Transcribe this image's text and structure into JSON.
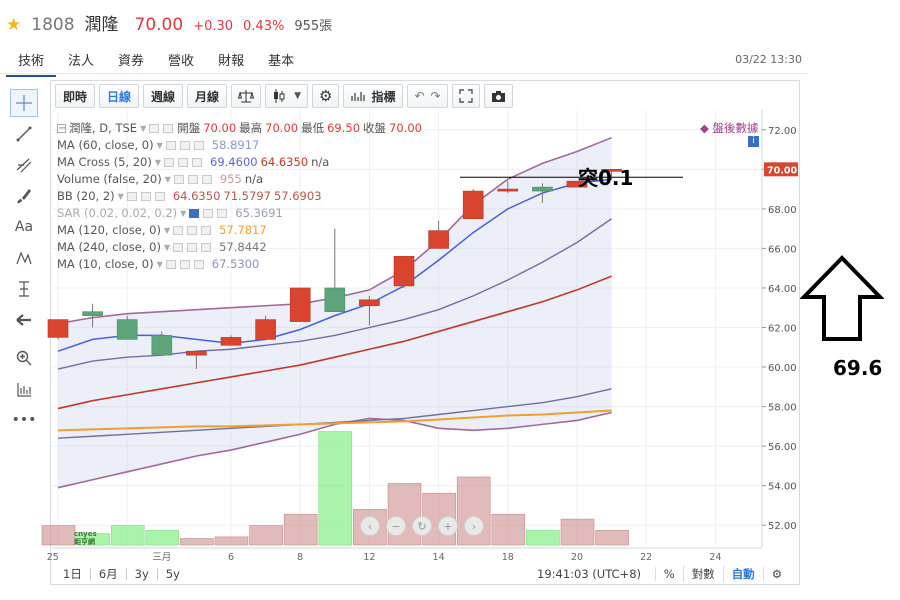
{
  "stock": {
    "symbol": "1808",
    "name": "潤隆",
    "price": "70.00",
    "change": "+0.30",
    "percent": "0.43%",
    "volume": "955張"
  },
  "nav": {
    "tabs": [
      {
        "label": "技術"
      },
      {
        "label": "法人"
      },
      {
        "label": "資券"
      },
      {
        "label": "營收"
      },
      {
        "label": "財報"
      },
      {
        "label": "基本"
      }
    ],
    "datetime": "03/22 13:30"
  },
  "toolbar": {
    "intraday": "即時",
    "daily": "日線",
    "weekly": "週線",
    "monthly": "月線",
    "indicators": "指標"
  },
  "legend": {
    "title": {
      "label": "潤隆, D, TSE",
      "open_l": "開盤",
      "open": "70.00",
      "high_l": "最高",
      "high": "70.00",
      "low_l": "最低",
      "low": "69.50",
      "close_l": "收盤",
      "close": "70.00"
    },
    "rows": [
      {
        "label": "MA (60, close, 0)",
        "value": "58.8917",
        "color": "#8899c9"
      },
      {
        "label": "MA Cross (5, 20)",
        "value": "69.4600",
        "value2": "64.6350",
        "extra": "n/a",
        "color": "#5b63d8",
        "color2": "#c0392b"
      },
      {
        "label": "Volume (false, 20)",
        "value": "955",
        "extra": "n/a",
        "color": "#c89c9c"
      },
      {
        "label": "BB (20, 2)",
        "value": "64.6350",
        "value2": "71.5797",
        "value3": "57.6903",
        "color": "#b8554f"
      },
      {
        "label": "SAR (0.02, 0.02, 0.2)",
        "value": "65.3691",
        "color": "#9aa0b0"
      },
      {
        "label": "MA (120, close, 0)",
        "value": "57.7817",
        "color": "#f0a030"
      },
      {
        "label": "MA (240, close, 0)",
        "value": "57.8442",
        "color": "#777"
      },
      {
        "label": "MA (10, close, 0)",
        "value": "67.5300",
        "color": "#8a92c0"
      }
    ]
  },
  "after_hours": "◆ 盤後數據",
  "info_icon_label": "i",
  "price_tag": "70.00",
  "chart_data": {
    "type": "candlestick",
    "y_axis": {
      "ticks": [
        "72.00",
        "70.00",
        "68.00",
        "66.00",
        "64.00",
        "62.00",
        "60.00",
        "58.00",
        "56.00",
        "54.00",
        "52.00"
      ],
      "range": [
        51.0,
        73.0
      ]
    },
    "x_axis": {
      "ticks": [
        "25",
        "三月",
        "6",
        "8",
        "12",
        "14",
        "18",
        "20",
        "22",
        "24"
      ]
    },
    "candles": [
      {
        "o": 61.5,
        "h": 62.4,
        "l": 61.4,
        "c": 62.4,
        "up": true
      },
      {
        "o": 62.6,
        "h": 63.2,
        "l": 62.0,
        "c": 62.8,
        "up": false
      },
      {
        "o": 61.4,
        "h": 62.6,
        "l": 61.4,
        "c": 62.4,
        "up": false
      },
      {
        "o": 60.6,
        "h": 61.8,
        "l": 60.6,
        "c": 61.6,
        "up": false
      },
      {
        "o": 60.6,
        "h": 60.8,
        "l": 59.9,
        "c": 60.8,
        "up": true
      },
      {
        "o": 61.1,
        "h": 61.6,
        "l": 61.1,
        "c": 61.5,
        "up": true
      },
      {
        "o": 61.4,
        "h": 62.6,
        "l": 61.4,
        "c": 62.4,
        "up": true
      },
      {
        "o": 62.3,
        "h": 64.0,
        "l": 62.3,
        "c": 64.0,
        "up": true
      },
      {
        "o": 62.8,
        "h": 67.0,
        "l": 62.8,
        "c": 64.0,
        "up": false
      },
      {
        "o": 63.1,
        "h": 63.6,
        "l": 62.1,
        "c": 63.4,
        "up": true
      },
      {
        "o": 64.1,
        "h": 65.6,
        "l": 64.0,
        "c": 65.6,
        "up": true
      },
      {
        "o": 66.0,
        "h": 67.4,
        "l": 66.0,
        "c": 66.9,
        "up": true
      },
      {
        "o": 67.5,
        "h": 69.0,
        "l": 67.5,
        "c": 68.9,
        "up": true
      },
      {
        "o": 68.9,
        "h": 69.4,
        "l": 68.8,
        "c": 69.0,
        "up": true
      },
      {
        "o": 69.1,
        "h": 69.3,
        "l": 68.3,
        "c": 68.9,
        "up": false
      },
      {
        "o": 69.1,
        "h": 69.4,
        "l": 69.1,
        "c": 69.4,
        "up": true
      },
      {
        "o": 70.0,
        "h": 70.0,
        "l": 69.5,
        "c": 70.0,
        "up": true
      }
    ],
    "volume": [
      {
        "v": 12,
        "up": true
      },
      {
        "v": 7,
        "up": false
      },
      {
        "v": 12,
        "up": false
      },
      {
        "v": 9,
        "up": false
      },
      {
        "v": 4,
        "up": true
      },
      {
        "v": 5,
        "up": true
      },
      {
        "v": 12,
        "up": true
      },
      {
        "v": 19,
        "up": true
      },
      {
        "v": 70,
        "up": false
      },
      {
        "v": 22,
        "up": true
      },
      {
        "v": 38,
        "up": true
      },
      {
        "v": 32,
        "up": true
      },
      {
        "v": 42,
        "up": true
      },
      {
        "v": 19,
        "up": true
      },
      {
        "v": 9,
        "up": false
      },
      {
        "v": 16,
        "up": true
      },
      {
        "v": 9,
        "up": true
      }
    ]
  },
  "bottom": {
    "ranges": [
      "1日",
      "6月",
      "3y",
      "5y"
    ],
    "time": "19:41:03 (UTC+8)",
    "pct": "%",
    "log": "對數",
    "auto": "自動"
  },
  "annotation": {
    "text": "突0.1",
    "value": "69.6"
  },
  "watermark": {
    "line1": "cnyes",
    "line2": "鉅亨網"
  }
}
